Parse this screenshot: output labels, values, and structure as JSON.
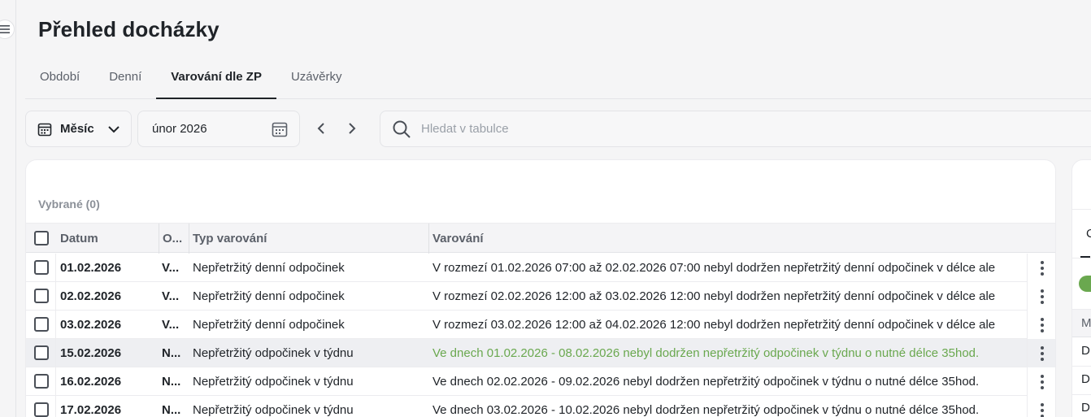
{
  "page": {
    "title": "Přehled docházky"
  },
  "tabs": [
    {
      "label": "Období",
      "active": false
    },
    {
      "label": "Denní",
      "active": false
    },
    {
      "label": "Varování dle ZP",
      "active": true
    },
    {
      "label": "Uzávěrky",
      "active": false
    }
  ],
  "toolbar": {
    "period_select": {
      "value": "Měsíc",
      "icon": "calendar-grid-icon"
    },
    "date_field": {
      "value": "únor 2026",
      "icon": "calendar-icon"
    },
    "prev_icon": "chevron-left-icon",
    "next_icon": "chevron-right-icon",
    "search": {
      "placeholder": "Hledat v tabulce",
      "value": "",
      "icon": "search-icon"
    }
  },
  "table": {
    "selected_label": "Vybrané (0)",
    "columns": [
      "Datum",
      "O...",
      "Typ varování",
      "Varování"
    ],
    "rows": [
      {
        "date": "01.02.2026",
        "o": "V...",
        "type": "Nepřetržitý denní odpočinek",
        "warning": "V rozmezí 01.02.2026 07:00 až 02.02.2026 07:00 nebyl dodržen nepřetržitý denní odpočinek v délce ale",
        "highlight": false
      },
      {
        "date": "02.02.2026",
        "o": "V...",
        "type": "Nepřetržitý denní odpočinek",
        "warning": "V rozmezí 02.02.2026 12:00 až 03.02.2026 12:00 nebyl dodržen nepřetržitý denní odpočinek v délce ale",
        "highlight": false
      },
      {
        "date": "03.02.2026",
        "o": "V...",
        "type": "Nepřetržitý denní odpočinek",
        "warning": "V rozmezí 03.02.2026 12:00 až 04.02.2026 12:00 nebyl dodržen nepřetržitý denní odpočinek v délce ale",
        "highlight": false
      },
      {
        "date": "15.02.2026",
        "o": "N...",
        "type": "Nepřetržitý odpočinek v týdnu",
        "warning": "Ve dnech 01.02.2026 - 08.02.2026 nebyl dodržen nepřetržitý odpočinek v týdnu o nutné délce 35hod.",
        "highlight": true
      },
      {
        "date": "16.02.2026",
        "o": "N...",
        "type": "Nepřetržitý odpočinek v týdnu",
        "warning": "Ve dnech 02.02.2026 - 09.02.2026 nebyl dodržen nepřetržitý odpočinek v týdnu o nutné délce 35hod.",
        "highlight": false
      },
      {
        "date": "17.02.2026",
        "o": "N...",
        "type": "Nepřetržitý odpočinek v týdnu",
        "warning": "Ve dnech 03.02.2026 - 10.02.2026 nebyl dodržen nepřetržitý odpočinek v týdnu o nutné délce 35hod.",
        "highlight": false
      }
    ]
  },
  "side_panel": {
    "tab_label": "C",
    "column_header": "M",
    "cells": [
      "D",
      "D",
      "D"
    ]
  },
  "colors": {
    "accent_green": "#6aa84f",
    "text_primary": "#1f2328",
    "text_muted": "#5b6069"
  }
}
